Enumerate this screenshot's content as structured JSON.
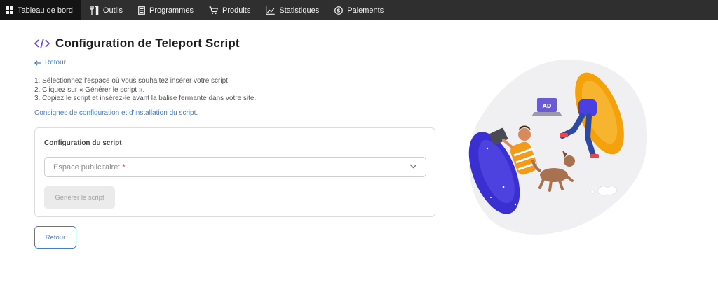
{
  "nav": {
    "items": [
      {
        "label": "Tableau de bord",
        "icon": "dashboard-grid-icon",
        "active": true
      },
      {
        "label": "Outils",
        "icon": "tools-icon",
        "active": false
      },
      {
        "label": "Programmes",
        "icon": "document-icon",
        "active": false
      },
      {
        "label": "Produits",
        "icon": "cart-icon",
        "active": false
      },
      {
        "label": "Statistiques",
        "icon": "chart-line-icon",
        "active": false
      },
      {
        "label": "Paiements",
        "icon": "dollar-coin-icon",
        "active": false
      }
    ]
  },
  "page": {
    "title": "Configuration de Teleport Script",
    "back_link": "Retour",
    "steps": [
      "1. Sélectionnez l'espace où vous souhaitez insérer votre script.",
      "2. Cliquez sur « Générer le script ».",
      "3. Copiez le script et insérez-le avant la balise fermante dans votre site."
    ],
    "help_link": "Consignes de configuration et d'installation du script."
  },
  "card": {
    "title": "Configuration du script",
    "select_placeholder": "Espace publicitaire:",
    "required_mark": "*",
    "generate_button": "Générer le script"
  },
  "footer": {
    "back_button": "Retour"
  },
  "colors": {
    "nav_bg": "#2f2f2f",
    "nav_active_bg": "#141414",
    "link_blue": "#3b7ed8",
    "code_icon_purple": "#6a4cd6",
    "required_red": "#e04545"
  }
}
